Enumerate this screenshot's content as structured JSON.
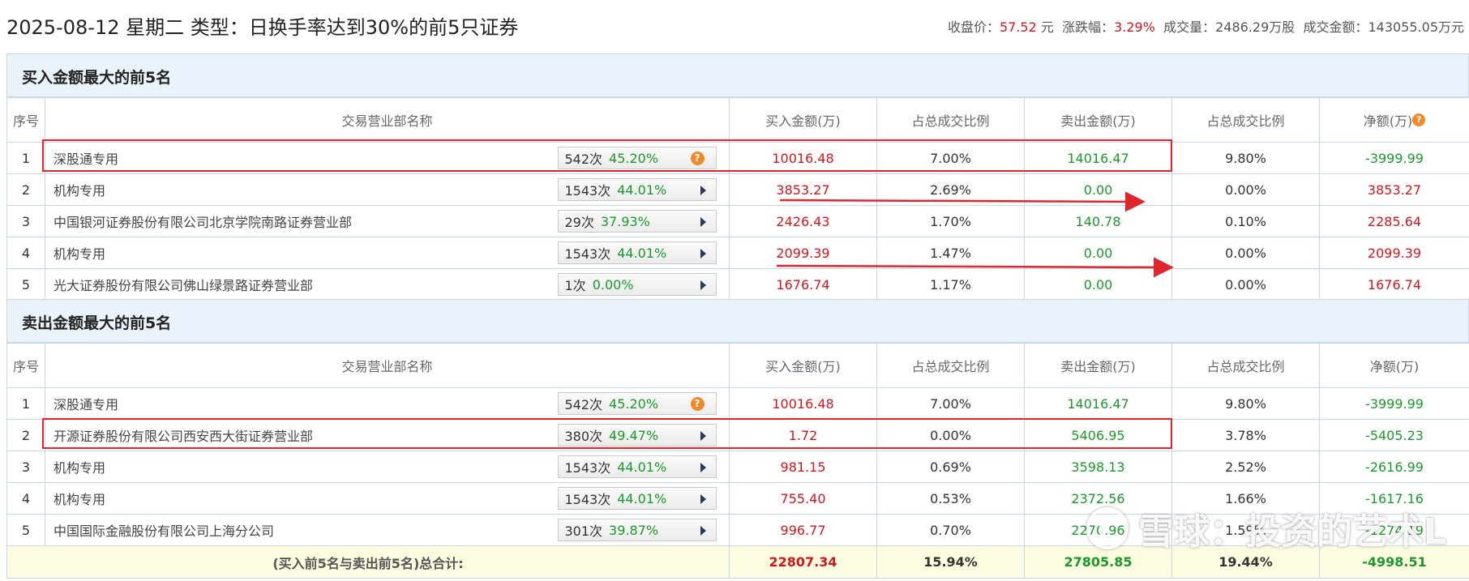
{
  "header": {
    "title": "2025-08-12 星期二 类型：日换手率达到30%的前5只证券",
    "close_label": "收盘价：",
    "close_value": "57.52",
    "close_unit": "元",
    "change_label": "涨跌幅：",
    "change_value": "3.29%",
    "volume_label": "成交量：",
    "volume_value": "2486.29万股",
    "amount_label": "成交金额：",
    "amount_value": "143055.05万元"
  },
  "columns": {
    "index": "序号",
    "name": "交易营业部名称",
    "buy_amount": "买入金额(万)",
    "buy_ratio": "占总成交比例",
    "sell_amount": "卖出金额(万)",
    "sell_ratio": "占总成交比例",
    "net": "净额(万)"
  },
  "buy_section": {
    "title": "买入金额最大的前5名",
    "rows": [
      {
        "idx": "1",
        "name": "深股通专用",
        "times": "542次",
        "rate": "45.20%",
        "buy": "10016.48",
        "buy_ratio": "7.00%",
        "sell": "14016.47",
        "sell_ratio": "9.80%",
        "net": "-3999.99"
      },
      {
        "idx": "2",
        "name": "机构专用",
        "times": "1543次",
        "rate": "44.01%",
        "buy": "3853.27",
        "buy_ratio": "2.69%",
        "sell": "0.00",
        "sell_ratio": "0.00%",
        "net": "3853.27"
      },
      {
        "idx": "3",
        "name": "中国银河证券股份有限公司北京学院南路证券营业部",
        "times": "29次",
        "rate": "37.93%",
        "buy": "2426.43",
        "buy_ratio": "1.70%",
        "sell": "140.78",
        "sell_ratio": "0.10%",
        "net": "2285.64"
      },
      {
        "idx": "4",
        "name": "机构专用",
        "times": "1543次",
        "rate": "44.01%",
        "buy": "2099.39",
        "buy_ratio": "1.47%",
        "sell": "0.00",
        "sell_ratio": "0.00%",
        "net": "2099.39"
      },
      {
        "idx": "5",
        "name": "光大证券股份有限公司佛山绿景路证券营业部",
        "times": "1次",
        "rate": "0.00%",
        "buy": "1676.74",
        "buy_ratio": "1.17%",
        "sell": "0.00",
        "sell_ratio": "0.00%",
        "net": "1676.74"
      }
    ]
  },
  "sell_section": {
    "title": "卖出金额最大的前5名",
    "rows": [
      {
        "idx": "1",
        "name": "深股通专用",
        "times": "542次",
        "rate": "45.20%",
        "buy": "10016.48",
        "buy_ratio": "7.00%",
        "sell": "14016.47",
        "sell_ratio": "9.80%",
        "net": "-3999.99"
      },
      {
        "idx": "2",
        "name": "开源证券股份有限公司西安西大街证券营业部",
        "times": "380次",
        "rate": "49.47%",
        "buy": "1.72",
        "buy_ratio": "0.00%",
        "sell": "5406.95",
        "sell_ratio": "3.78%",
        "net": "-5405.23"
      },
      {
        "idx": "3",
        "name": "机构专用",
        "times": "1543次",
        "rate": "44.01%",
        "buy": "981.15",
        "buy_ratio": "0.69%",
        "sell": "3598.13",
        "sell_ratio": "2.52%",
        "net": "-2616.99"
      },
      {
        "idx": "4",
        "name": "机构专用",
        "times": "1543次",
        "rate": "44.01%",
        "buy": "755.40",
        "buy_ratio": "0.53%",
        "sell": "2372.56",
        "sell_ratio": "1.66%",
        "net": "-1617.16"
      },
      {
        "idx": "5",
        "name": "中国国际金融股份有限公司上海分公司",
        "times": "301次",
        "rate": "39.87%",
        "buy": "996.77",
        "buy_ratio": "0.70%",
        "sell": "2270.96",
        "sell_ratio": "1.59%",
        "net": "-1274.19"
      }
    ]
  },
  "total": {
    "label": "(买入前5名与卖出前5名)总合计:",
    "buy": "22807.34",
    "buy_ratio": "15.94%",
    "sell": "27805.85",
    "sell_ratio": "19.44%",
    "net": "-4998.51"
  },
  "watermark": {
    "text": "雪球：投资的艺术L"
  },
  "colors": {
    "up": "#d3161c",
    "down": "#1a9a2a",
    "highlight": "#e0262b",
    "section_bg": "#eaf2fb",
    "total_bg": "#fdfbe0"
  }
}
